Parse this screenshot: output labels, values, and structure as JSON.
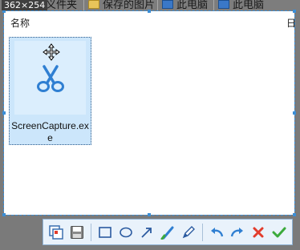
{
  "tabs": [
    {
      "label": "章义件夹",
      "icon": "folder-icon"
    },
    {
      "label": "保存的图片",
      "icon": "folder-icon"
    },
    {
      "label": "此电脑",
      "icon": "computer-icon"
    },
    {
      "label": "此电脑",
      "icon": "computer-icon"
    }
  ],
  "capture": {
    "coordinates": "362×254"
  },
  "explorer": {
    "column_header": "名称",
    "column_header_right": "日",
    "file": {
      "name": "ScreenCapture.exe",
      "icon": "scissors-icon"
    }
  },
  "toolbar": {
    "buttons": [
      {
        "name": "mosaic",
        "icon": "mosaic-icon"
      },
      {
        "name": "save",
        "icon": "save-icon"
      },
      {
        "name": "rectangle",
        "icon": "rectangle-icon"
      },
      {
        "name": "ellipse",
        "icon": "ellipse-icon"
      },
      {
        "name": "arrow",
        "icon": "arrow-icon"
      },
      {
        "name": "brush",
        "icon": "brush-icon"
      },
      {
        "name": "pen",
        "icon": "pen-icon"
      },
      {
        "name": "undo",
        "icon": "undo-icon"
      },
      {
        "name": "redo",
        "icon": "redo-icon"
      },
      {
        "name": "cancel",
        "icon": "close-icon"
      },
      {
        "name": "confirm",
        "icon": "check-icon"
      }
    ]
  },
  "colors": {
    "selection": "#3b8ed6",
    "cancel": "#e23c2c",
    "confirm": "#3caa3c",
    "icon_blue": "#2f7fd2"
  }
}
